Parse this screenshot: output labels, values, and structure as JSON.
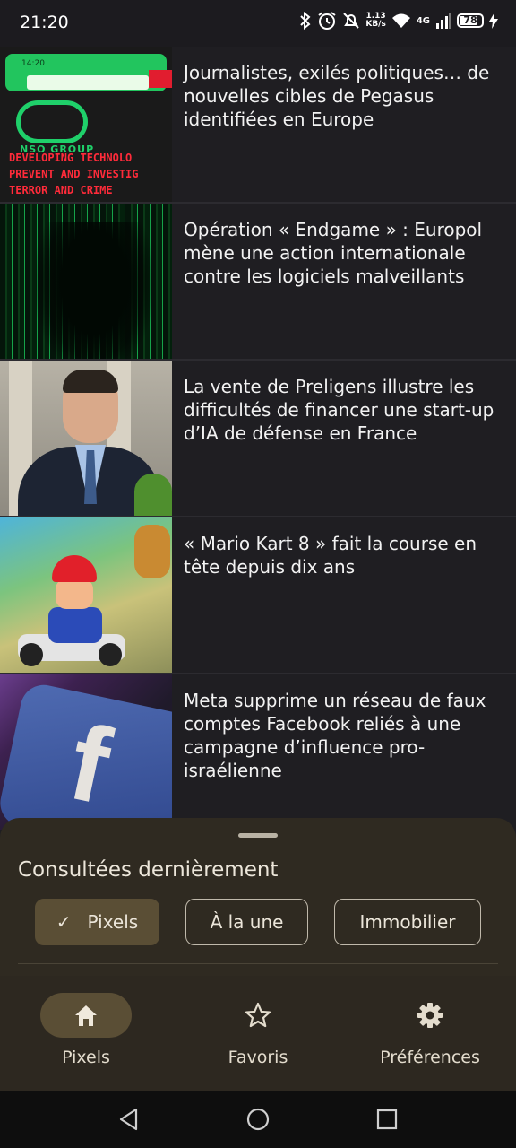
{
  "status_bar": {
    "time": "21:20",
    "net_speed_value": "1.13",
    "net_speed_unit": "KB/s",
    "network": "4G",
    "battery": "78"
  },
  "articles": [
    {
      "title": "Journalistes, exilés politiques… de nouvelles cibles de Pegasus identifiées en Europe",
      "thumb_text": {
        "time": "14:20",
        "logo": "NSO GROUP",
        "line1": "DEVELOPING TECHNOLO",
        "line2": "PREVENT AND INVESTIG",
        "line3": "TERROR AND CRIME"
      }
    },
    {
      "title": "Opération « Endgame » : Europol mène une action internationale contre les logiciels malveillants"
    },
    {
      "title": "La vente de Preligens illustre les difficultés de financer une start-up d’IA de défense en France"
    },
    {
      "title": "« Mario Kart 8 » fait la course en tête depuis dix ans"
    },
    {
      "title": "Meta supprime un réseau de faux comptes Facebook reliés à une campagne d’influence pro-israélienne",
      "thumb_text": {
        "logo": "f"
      }
    }
  ],
  "recent": {
    "title": "Consultées dernièrement",
    "chips": [
      {
        "label": "Pixels",
        "selected": true
      },
      {
        "label": "À la une",
        "selected": false
      },
      {
        "label": "Immobilier",
        "selected": false
      }
    ]
  },
  "bottom_nav": {
    "items": [
      {
        "label": "Pixels",
        "icon": "home-icon",
        "active": true
      },
      {
        "label": "Favoris",
        "icon": "star-icon",
        "active": false
      },
      {
        "label": "Préférences",
        "icon": "gear-icon",
        "active": false
      }
    ]
  },
  "colors": {
    "background": "#1f1e22",
    "sheet": "#2f2a21",
    "selected_chip": "#5a4e35",
    "text": "#ece6da"
  }
}
